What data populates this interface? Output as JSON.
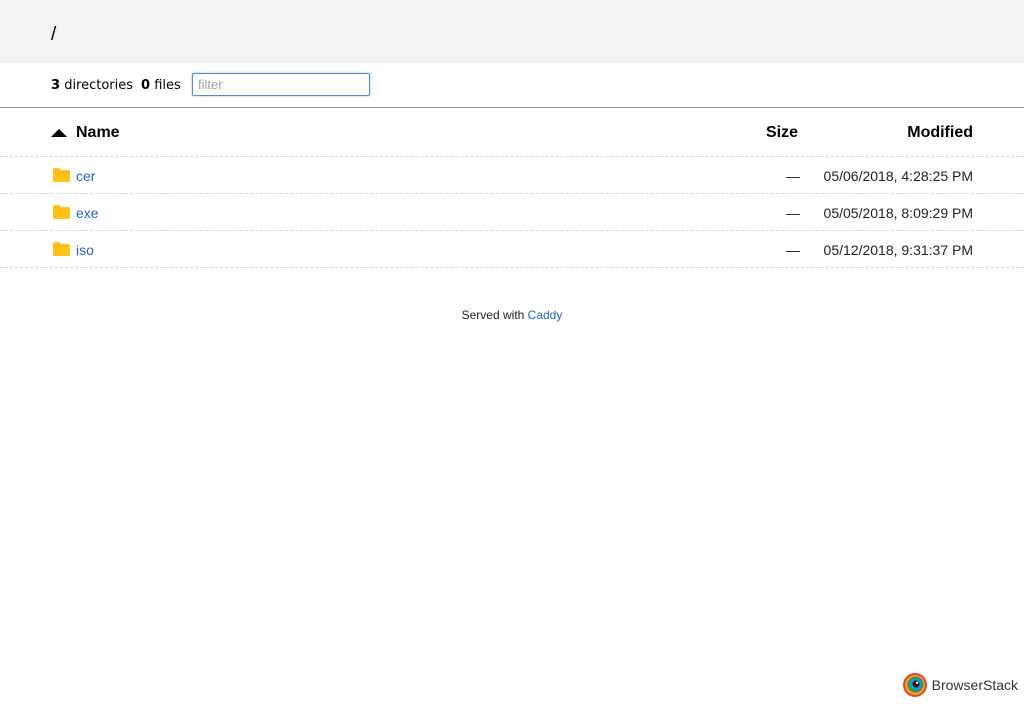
{
  "breadcrumb": "/",
  "summary": {
    "directories_count": "3",
    "directories_label": "directories",
    "files_count": "0",
    "files_label": "files"
  },
  "filter": {
    "placeholder": "filter",
    "value": ""
  },
  "table": {
    "columns": {
      "name": "Name",
      "size": "Size",
      "modified": "Modified"
    },
    "sort": "name-ascending",
    "rows": [
      {
        "name": "cer",
        "size": "—",
        "modified": "05/06/2018, 4:28:25 PM",
        "icon": "folder-icon"
      },
      {
        "name": "exe",
        "size": "—",
        "modified": "05/05/2018, 8:09:29 PM",
        "icon": "folder-icon"
      },
      {
        "name": "iso",
        "size": "—",
        "modified": "05/12/2018, 9:31:37 PM",
        "icon": "folder-icon"
      }
    ]
  },
  "footer": {
    "prefix": "Served with",
    "link": "Caddy"
  },
  "badge": {
    "text": "BrowserStack"
  },
  "colors": {
    "link": "#2266cc",
    "folder": "#ffc21a",
    "header_bg": "#f2f2f2",
    "filter_border": "#4a90d9"
  }
}
